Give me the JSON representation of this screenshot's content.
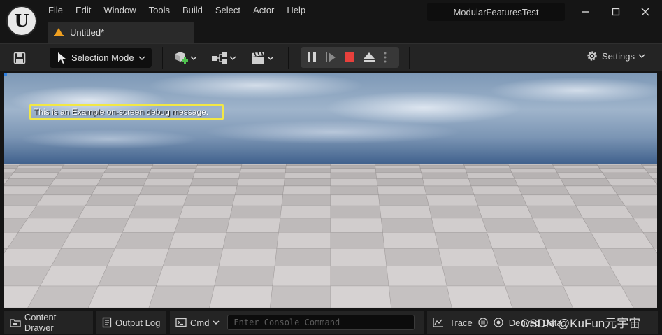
{
  "menu": {
    "items": [
      "File",
      "Edit",
      "Window",
      "Tools",
      "Build",
      "Select",
      "Actor",
      "Help"
    ]
  },
  "project_name": "ModularFeaturesTest",
  "tab": {
    "label": "Untitled*"
  },
  "toolbar": {
    "selection_mode_label": "Selection Mode",
    "settings_label": "Settings"
  },
  "viewport": {
    "debug_message": "This is an Example on-screen debug message."
  },
  "statusbar": {
    "content_drawer_label": "Content Drawer",
    "output_log_label": "Output Log",
    "cmd_label": "Cmd",
    "console_placeholder": "Enter Console Command",
    "trace_label": "Trace",
    "derived_data_label": "Derived Data"
  },
  "watermark": "CSDN @KuFun元宇宙",
  "colors": {
    "accent_orange": "#f0a020",
    "stop_red": "#e8403c",
    "debug_outline": "#f2e744",
    "add_green": "#4fc34f"
  },
  "icons": {
    "save": "save-icon",
    "selection": "cursor-icon",
    "add_actor": "cube-add-icon",
    "blueprint": "blueprint-icon",
    "cinematics": "clapper-icon",
    "pause": "pause-icon",
    "step": "skip-frame-icon",
    "stop": "stop-icon",
    "eject": "eject-icon",
    "settings": "gear-icon"
  }
}
